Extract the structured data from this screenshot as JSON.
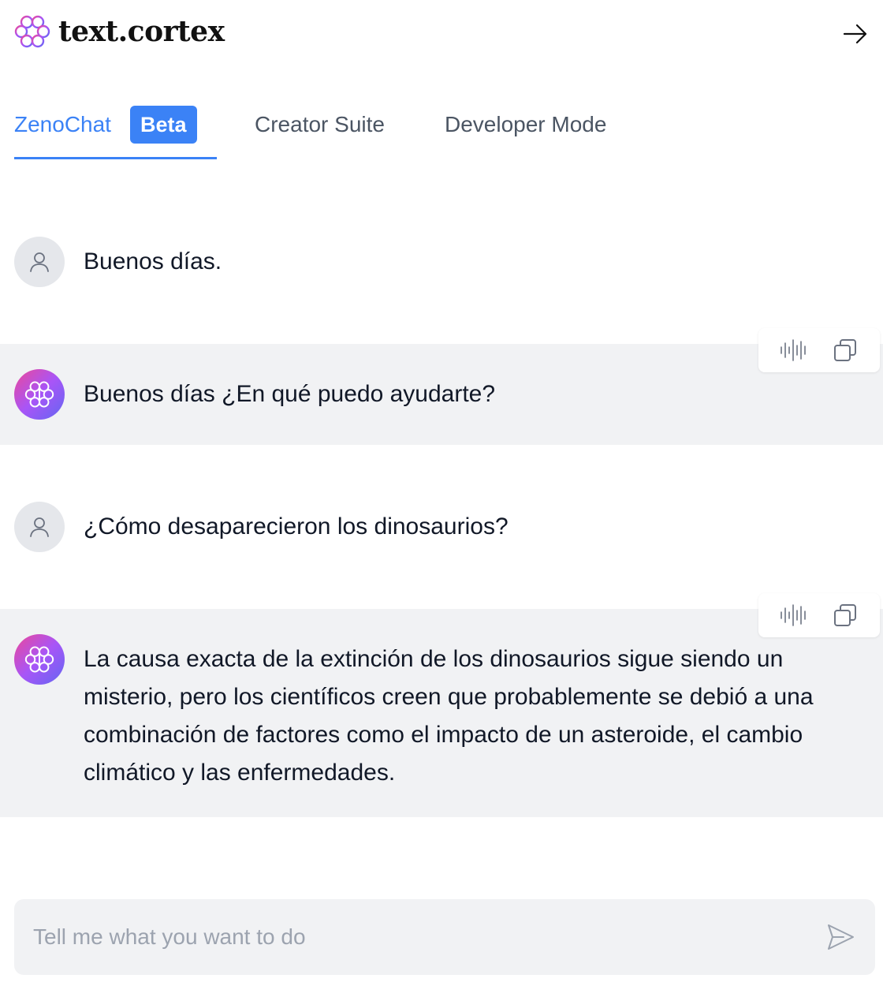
{
  "app": {
    "brand": "text.cortex",
    "logo_icon": "brain-icon",
    "collapse_icon": "arrow-right-icon",
    "colors": {
      "accent": "#3b82f6",
      "bot_row_background": "#f1f2f4",
      "avatar_gradient": [
        "#ec4899",
        "#a855f7",
        "#6366f1"
      ]
    }
  },
  "tabs": [
    {
      "label": "ZenoChat",
      "badge": "Beta",
      "active": true
    },
    {
      "label": "Creator Suite",
      "active": false
    },
    {
      "label": "Developer Mode",
      "active": false
    }
  ],
  "messages": [
    {
      "role": "user",
      "avatar_icon": "user-icon",
      "text": "Buenos días."
    },
    {
      "role": "assistant",
      "avatar_icon": "brain-icon",
      "text": "Buenos días ¿En qué puedo ayudarte?",
      "actions": [
        "audio-wave-icon",
        "copy-icon"
      ]
    },
    {
      "role": "user",
      "avatar_icon": "user-icon",
      "text": "¿Cómo desaparecieron los dinosaurios?"
    },
    {
      "role": "assistant",
      "avatar_icon": "brain-icon",
      "text": "La causa exacta de la extinción de los dinosaurios sigue siendo un misterio, pero los científicos creen que probablemente se debió a una combinación de factores como el impacto de un asteroide, el cambio climático y las enfermedades.",
      "actions": [
        "audio-wave-icon",
        "copy-icon"
      ]
    }
  ],
  "composer": {
    "placeholder": "Tell me what you want to do",
    "value": "",
    "send_icon": "send-icon"
  }
}
